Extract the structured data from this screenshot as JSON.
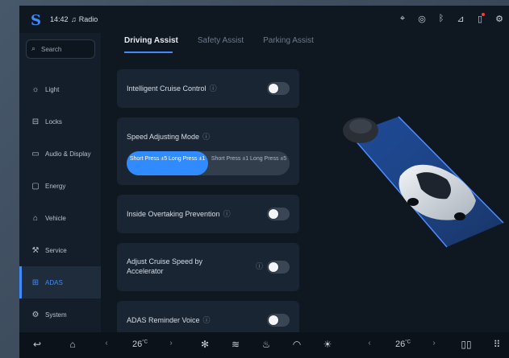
{
  "status": {
    "logo": "S",
    "time": "14:42",
    "radio_label": "Radio",
    "icons": [
      "location-icon",
      "steering-icon",
      "bluetooth-icon",
      "signal-icon",
      "notification-icon",
      "settings-icon"
    ]
  },
  "sidebar": {
    "search_placeholder": "Search",
    "items": [
      {
        "label": "Light",
        "icon": "bulb-icon"
      },
      {
        "label": "Locks",
        "icon": "lock-icon"
      },
      {
        "label": "Audio & Display",
        "icon": "display-icon"
      },
      {
        "label": "Energy",
        "icon": "battery-icon"
      },
      {
        "label": "Vehicle",
        "icon": "car-icon"
      },
      {
        "label": "Service",
        "icon": "wrench-icon"
      },
      {
        "label": "ADAS",
        "icon": "adas-icon",
        "active": true
      },
      {
        "label": "System",
        "icon": "gear-icon"
      }
    ]
  },
  "tabs": [
    {
      "label": "Driving Assist",
      "active": true
    },
    {
      "label": "Safety Assist",
      "active": false
    },
    {
      "label": "Parking Assist",
      "active": false
    }
  ],
  "settings": {
    "cruise": {
      "label": "Intelligent Cruise Control",
      "enabled": false
    },
    "speed_mode": {
      "label": "Speed Adjusting Mode",
      "option_selected": "Short Press ±5 Long Press ±1",
      "option_other": "Short Press ±1 Long Press ±5"
    },
    "overtaking": {
      "label": "Inside Overtaking Prevention",
      "enabled": false
    },
    "accel": {
      "label_line1": "Adjust Cruise Speed by",
      "label_line2": "Accelerator",
      "enabled": false
    },
    "voice": {
      "label": "ADAS Reminder Voice",
      "enabled": false
    }
  },
  "bottom": {
    "temp_left": "26",
    "temp_right": "26",
    "temp_unit": "°C"
  },
  "colors": {
    "accent": "#3d8bff",
    "background": "#0f1721",
    "card": "#1a2533"
  }
}
